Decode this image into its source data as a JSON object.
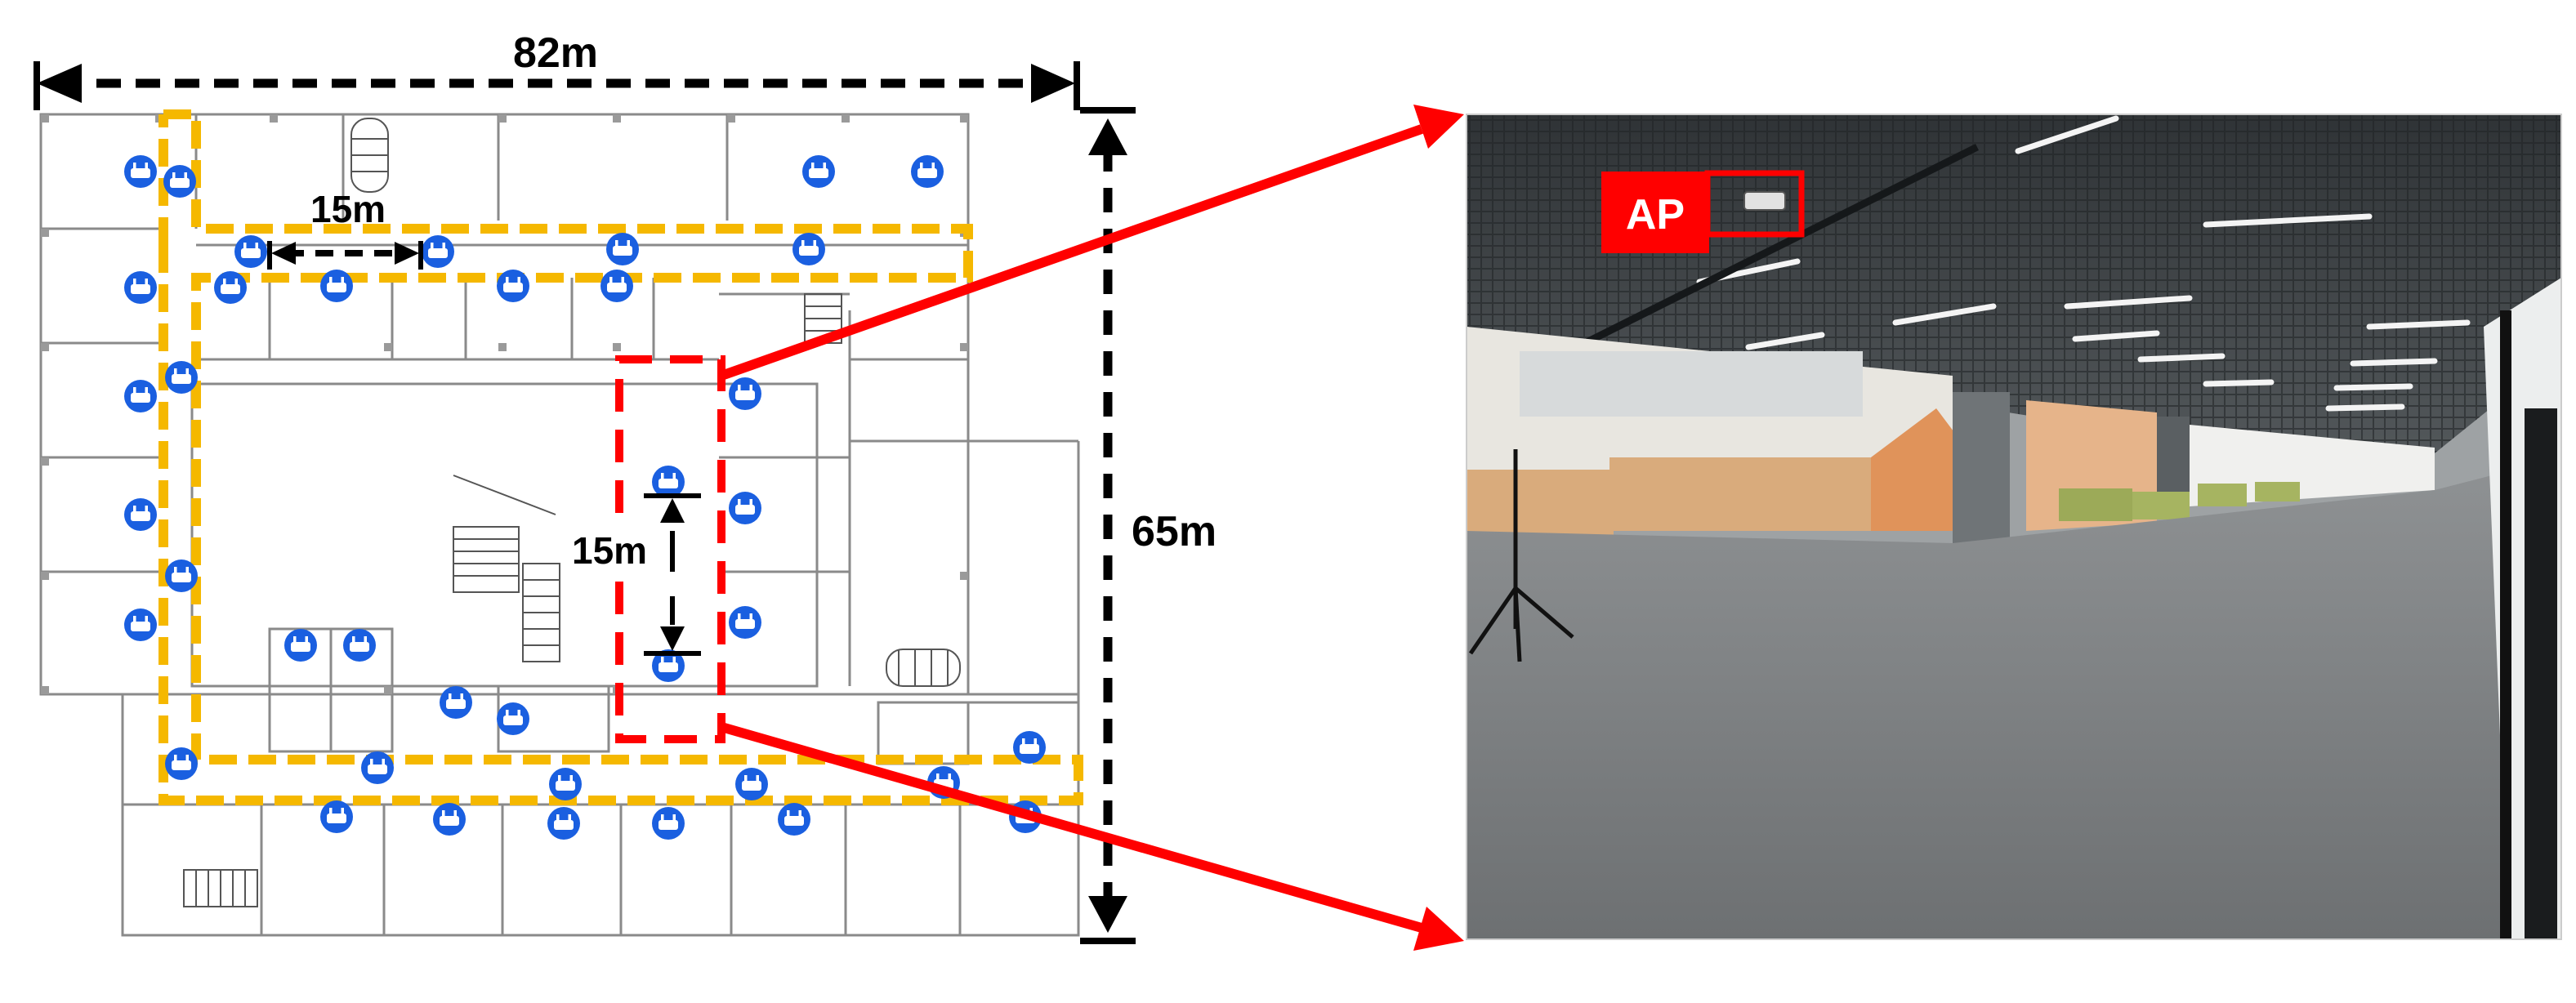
{
  "dimensions": {
    "width_label": "82m",
    "height_label": "65m",
    "spacing_horizontal_label": "15m",
    "spacing_vertical_label": "15m"
  },
  "photo": {
    "ap_label": "AP"
  },
  "colors": {
    "path_yellow": "#f5b800",
    "highlight_red": "#ff0000",
    "ap_icon_blue": "#1a5fe0",
    "dimension_black": "#000000",
    "wall_grey": "#8a8a8a"
  },
  "icons": {
    "access_point": "wifi-access-point-icon"
  }
}
